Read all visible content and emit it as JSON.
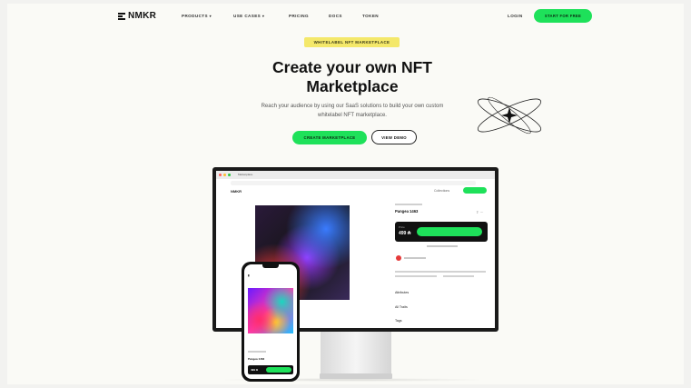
{
  "nav": {
    "logo": "NMKR",
    "links": [
      {
        "label": "PRODUCTS",
        "dropdown": true
      },
      {
        "label": "USE CASES",
        "dropdown": true
      },
      {
        "label": "PRICING",
        "dropdown": false
      },
      {
        "label": "DOCS",
        "dropdown": false
      },
      {
        "label": "TOKEN",
        "dropdown": false
      }
    ],
    "login": "LOGIN",
    "cta": "START FOR FREE",
    "caret": "▾"
  },
  "hero": {
    "badge": "WHITELABEL NFT MARKETPLACE",
    "title_line1": "Create your own NFT",
    "title_line2": "Marketplace",
    "subtitle_line1": "Reach your audience by using our SaaS solutions to build your own custom",
    "subtitle_line2": "whitelabel NFT marketplace.",
    "primary_button": "CREATE MARKETPLACE",
    "secondary_button": "VIEW DEMO"
  },
  "mockup": {
    "tab_title": "Marketplace",
    "site_logo": "NMKR",
    "site_link": "Collections",
    "nft_title": "Pangea 1463",
    "price_label": "Price",
    "price": "499 ₳",
    "sections": [
      "Attributes",
      "All Traits",
      "Tags"
    ],
    "phone_title": "Pangea 1463",
    "phone_price": "499 ₳"
  },
  "colors": {
    "accent": "#1ee15a",
    "badge": "#f4e86a",
    "text": "#111111"
  }
}
